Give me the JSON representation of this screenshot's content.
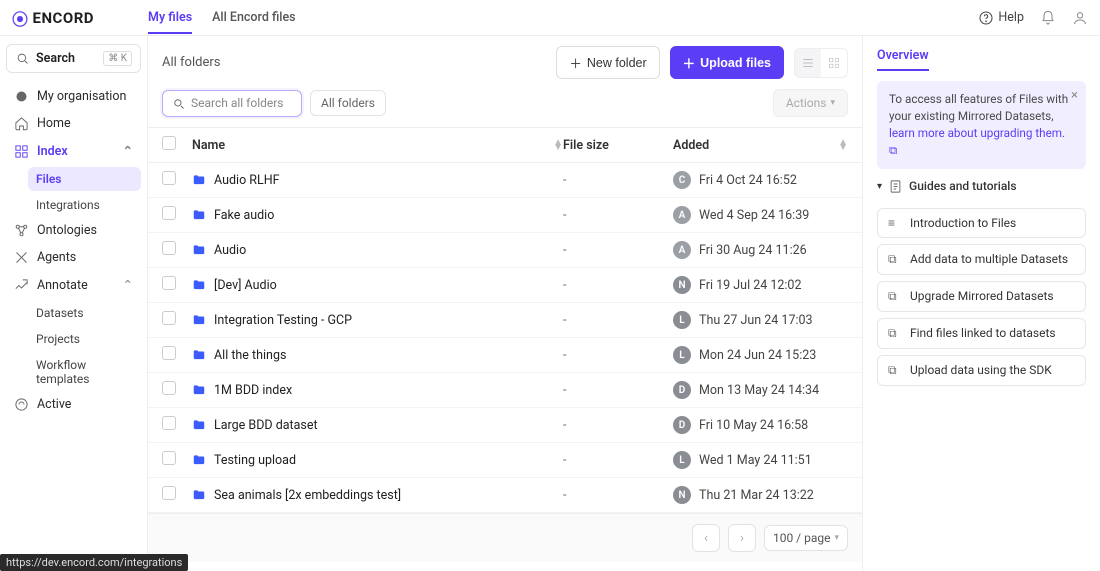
{
  "brand": "ENCORD",
  "top_tabs": {
    "my_files": "My files",
    "all_files": "All Encord files"
  },
  "help_label": "Help",
  "sidebar": {
    "search_label": "Search",
    "search_kbd": "⌘ K",
    "org_label": "My organisation",
    "home_label": "Home",
    "index_label": "Index",
    "index_children": {
      "files": "Files",
      "integrations": "Integrations"
    },
    "ontologies_label": "Ontologies",
    "agents_label": "Agents",
    "annotate_label": "Annotate",
    "annotate_children": {
      "datasets": "Datasets",
      "projects": "Projects",
      "workflow": "Workflow templates"
    },
    "active_label": "Active"
  },
  "main": {
    "breadcrumb": "All folders",
    "new_folder_btn": "New folder",
    "upload_btn": "Upload files",
    "search_placeholder": "Search all folders",
    "filter_chip": "All folders",
    "actions_label": "Actions",
    "columns": {
      "name": "Name",
      "size": "File size",
      "added": "Added"
    },
    "rows": [
      {
        "name": "Audio RLHF",
        "size": "-",
        "avatar": "C",
        "added": "Fri 4 Oct 24 16:52"
      },
      {
        "name": "Fake audio",
        "size": "-",
        "avatar": "A",
        "added": "Wed 4 Sep 24 16:39"
      },
      {
        "name": "Audio",
        "size": "-",
        "avatar": "A",
        "added": "Fri 30 Aug 24 11:26"
      },
      {
        "name": "[Dev] Audio",
        "size": "-",
        "avatar": "N",
        "added": "Fri 19 Jul 24 12:02"
      },
      {
        "name": "Integration Testing - GCP",
        "size": "-",
        "avatar": "L",
        "added": "Thu 27 Jun 24 17:03"
      },
      {
        "name": "All the things",
        "size": "-",
        "avatar": "L",
        "added": "Mon 24 Jun 24 15:23"
      },
      {
        "name": "1M BDD index",
        "size": "-",
        "avatar": "D",
        "added": "Mon 13 May 24 14:34"
      },
      {
        "name": "Large BDD dataset",
        "size": "-",
        "avatar": "D",
        "added": "Fri 10 May 24 16:58"
      },
      {
        "name": "Testing upload",
        "size": "-",
        "avatar": "L",
        "added": "Wed 1 May 24 11:51"
      },
      {
        "name": "Sea animals [2x embeddings test]",
        "size": "-",
        "avatar": "N",
        "added": "Thu 21 Mar 24 13:22"
      }
    ],
    "page_size": "100 / page"
  },
  "right": {
    "tab": "Overview",
    "info_text_1": "To access all features of Files with your existing Mirrored Datasets, ",
    "info_link": "learn more about upgrading them.",
    "guides_header": "Guides and tutorials",
    "guides": [
      "Introduction to Files",
      "Add data to multiple Datasets",
      "Upgrade Mirrored Datasets",
      "Find files linked to datasets",
      "Upload data using the SDK"
    ]
  },
  "status_url": "https://dev.encord.com/integrations"
}
